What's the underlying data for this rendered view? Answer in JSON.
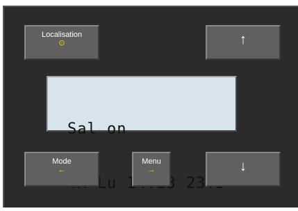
{
  "buttons": {
    "localisation": {
      "label": "Localisation",
      "sub_icon": "⊙"
    },
    "up": {
      "icon": "↑"
    },
    "mode": {
      "label": "Mode",
      "sub_icon": "←"
    },
    "menu": {
      "label": "Menu",
      "sub_icon": "→"
    },
    "down": {
      "icon": "↓"
    }
  },
  "display": {
    "line1": "Sal on",
    "line2": "☾A Lu 14:23 23.5°"
  },
  "colors": {
    "panel": "#2b2b2b",
    "button": "#606060",
    "accent": "#f5d400",
    "lcd_background": "#d8e4ec"
  }
}
